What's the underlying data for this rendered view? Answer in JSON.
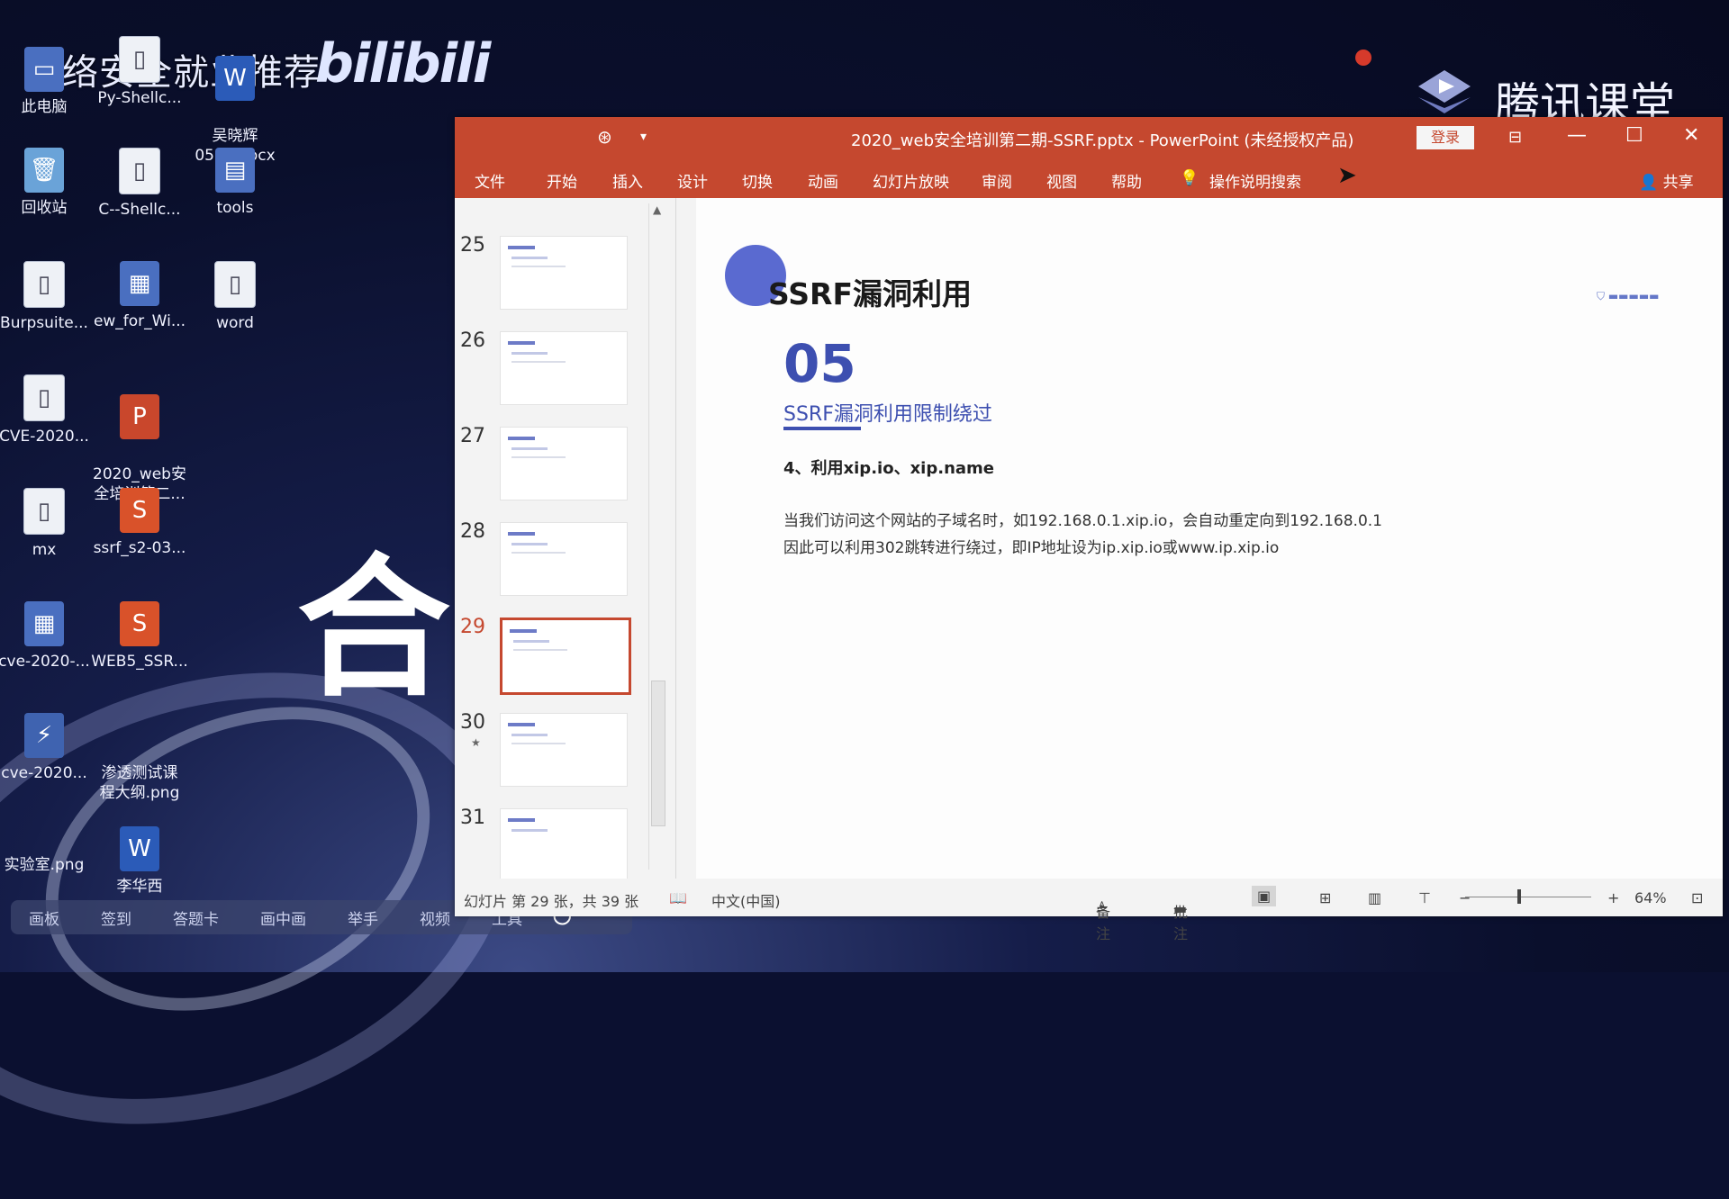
{
  "watermarks": {
    "left_text": "网络安全就业推荐",
    "bilibili": "bilibili",
    "tencent": "腾讯课堂",
    "overlay_char": "合"
  },
  "desktop_icons": [
    {
      "label": "此电脑",
      "icon": "computer-icon"
    },
    {
      "label": "Py-Shellc...",
      "icon": "file-icon"
    },
    {
      "label": "吴晓辉\n0515.docx",
      "icon": "word-icon"
    },
    {
      "label": "回收站",
      "icon": "recycle-bin-icon"
    },
    {
      "label": "C--Shellc...",
      "icon": "file-icon"
    },
    {
      "label": "tools",
      "icon": "folder-icon"
    },
    {
      "label": "Burpsuite...",
      "icon": "file-icon"
    },
    {
      "label": "ew_for_Wi...",
      "icon": "image-icon"
    },
    {
      "label": "word",
      "icon": "file-icon"
    },
    {
      "label": "CVE-2020...",
      "icon": "file-icon"
    },
    {
      "label": "2020_web安\n全培训第二...",
      "icon": "powerpoint-icon"
    },
    {
      "label": "mx",
      "icon": "file-icon"
    },
    {
      "label": "ssrf_s2-03...",
      "icon": "sublime-icon"
    },
    {
      "label": "cve-2020-...",
      "icon": "image-icon"
    },
    {
      "label": "WEB5_SSR...",
      "icon": "sublime-icon"
    },
    {
      "label": "cve-2020...",
      "icon": "zip-icon"
    },
    {
      "label": "渗透测试课\n程大纲.png",
      "icon": "image-icon"
    },
    {
      "label": "实验室.png",
      "icon": "image-icon"
    },
    {
      "label": "李华西",
      "icon": "word-icon"
    }
  ],
  "taskbar": {
    "items": [
      "画板",
      "签到",
      "答题卡",
      "画中画",
      "举手",
      "视频",
      "工具"
    ]
  },
  "powerpoint": {
    "title": "2020_web安全培训第二期-SSRF.pptx  -  PowerPoint (未经授权产品)",
    "login_label": "登录",
    "tabs": [
      "文件",
      "开始",
      "插入",
      "设计",
      "切换",
      "动画",
      "幻灯片放映",
      "审阅",
      "视图",
      "帮助"
    ],
    "search_label": "操作说明搜索",
    "share_label": "共享",
    "thumbnails": [
      "25",
      "26",
      "27",
      "28",
      "29",
      "30",
      "31"
    ],
    "selected_slide": "29",
    "slide": {
      "title": "SSRF漏洞利用",
      "section_number": "05",
      "section_title": "SSRF漏洞利用限制绕过",
      "point": "4、利用xip.io、xip.name",
      "body_line1": "当我们访问这个网站的子域名时，如192.168.0.1.xip.io，会自动重定向到192.168.0.1",
      "body_line2": "因此可以利用302跳转进行绕过，即IP地址设为ip.xip.io或www.ip.xip.io"
    },
    "status": {
      "slide_counter": "幻灯片 第 29 张，共 39 张",
      "language": "中文(中国)",
      "notes_label": "备注",
      "comments_label": "批注",
      "zoom": "64%"
    }
  }
}
